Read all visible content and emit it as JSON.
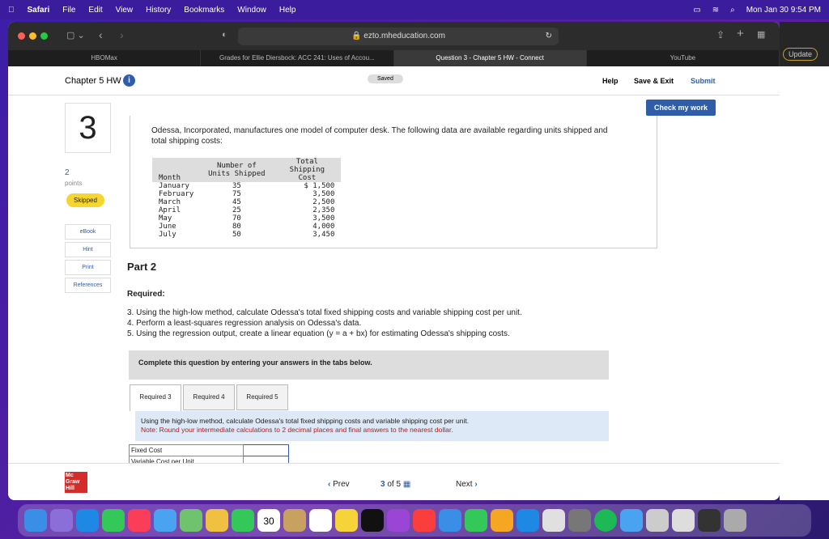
{
  "menubar": {
    "app": "Safari",
    "items": [
      "File",
      "Edit",
      "View",
      "History",
      "Bookmarks",
      "Window",
      "Help"
    ],
    "clock": "Mon Jan 30  9:54 PM"
  },
  "browser": {
    "url": "ezto.mheducation.com",
    "tabs": [
      "HBOMax",
      "Grades for Ellie Diersbock: ACC 241: Uses of Accou...",
      "Question 3 - Chapter 5 HW - Connect",
      "YouTube"
    ],
    "update": "Update"
  },
  "header": {
    "title": "Chapter 5 HW",
    "saved": "Saved",
    "help": "Help",
    "save_exit": "Save & Exit",
    "submit": "Submit",
    "check": "Check my work"
  },
  "sidebar": {
    "number": "3",
    "points": "2",
    "points_label": "points",
    "status": "Skipped",
    "links": [
      "eBook",
      "Hint",
      "Print",
      "References"
    ]
  },
  "question": {
    "intro": "Odessa, Incorporated, manufactures one model of computer desk. The following data are available regarding units shipped and total shipping costs:",
    "table": {
      "headers": [
        "Month",
        "Number of Units Shipped",
        "Total Shipping Cost"
      ],
      "rows": [
        [
          "January",
          "35",
          "$ 1,500"
        ],
        [
          "February",
          "75",
          "3,500"
        ],
        [
          "March",
          "45",
          "2,500"
        ],
        [
          "April",
          "25",
          "2,350"
        ],
        [
          "May",
          "70",
          "3,500"
        ],
        [
          "June",
          "80",
          "4,000"
        ],
        [
          "July",
          "50",
          "3,450"
        ]
      ]
    },
    "part": "Part 2",
    "required": "Required:",
    "items": [
      "3. Using the high-low method, calculate Odessa's total fixed shipping costs and variable shipping cost per unit.",
      "4. Perform a least-squares regression analysis on Odessa's data.",
      "5. Using the regression output, create a linear equation (y = a + bx) for estimating Odessa's shipping costs."
    ],
    "complete": "Complete this question by entering your answers in the tabs below.",
    "tabs": [
      "Required 3",
      "Required 4",
      "Required 5"
    ],
    "instruction": "Using the high-low method, calculate Odessa's total fixed shipping costs and variable shipping cost per unit.",
    "note": "Note: Round your intermediate calculations to 2 decimal places and final answers to the nearest dollar.",
    "answers": [
      {
        "label": "Fixed Cost",
        "value": ""
      },
      {
        "label": "Variable Cost per Unit",
        "value": ""
      }
    ]
  },
  "footer": {
    "prev": "Prev",
    "page": "3",
    "of": "of 5",
    "next": "Next",
    "logo": "Mc Graw Hill"
  },
  "dock": {
    "calendar_day": "30"
  }
}
